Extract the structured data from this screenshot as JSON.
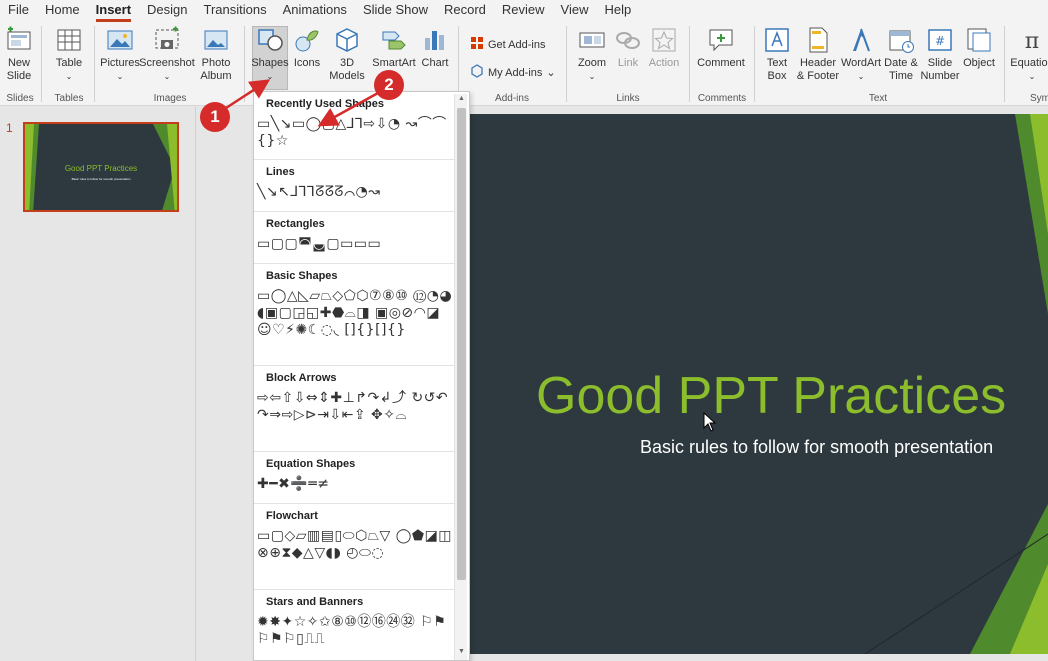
{
  "menu": {
    "tabs": [
      "File",
      "Home",
      "Insert",
      "Design",
      "Transitions",
      "Animations",
      "Slide Show",
      "Record",
      "Review",
      "View",
      "Help"
    ],
    "active": "Insert"
  },
  "ribbon": {
    "new_slide": "New",
    "new_slide2": "Slide",
    "table": "Table",
    "pictures": "Pictures",
    "screenshot": "Screenshot",
    "photo_album": "Photo",
    "photo_album2": "Album",
    "shapes": "Shapes",
    "icons": "Icons",
    "models": "3D",
    "models2": "Models",
    "smartart": "SmartArt",
    "chart": "Chart",
    "get_addins": "Get Add-ins",
    "my_addins": "My Add-ins",
    "zoom": "Zoom",
    "link": "Link",
    "action": "Action",
    "comment": "Comment",
    "text_box": "Text",
    "text_box2": "Box",
    "header_footer": "Header",
    "header_footer2": "& Footer",
    "wordart": "WordArt",
    "date_time": "Date &",
    "date_time2": "Time",
    "slide_number": "Slide",
    "slide_number2": "Number",
    "object": "Object",
    "equation": "Equation",
    "groups": {
      "slides": "Slides",
      "tables": "Tables",
      "images": "Images",
      "addins": "Add-ins",
      "links": "Links",
      "comments": "Comments",
      "text": "Text",
      "symbols": "Sym"
    }
  },
  "thumbnail": {
    "number": "1",
    "title": "Good PPT Practices",
    "subtitle": "Basic rules to follow for smooth presentation"
  },
  "slide": {
    "title": "Good PPT Practices",
    "subtitle": "Basic rules to follow for smooth presentation"
  },
  "shapes_menu": {
    "recent": "Recently Used Shapes",
    "lines": "Lines",
    "rectangles": "Rectangles",
    "basic": "Basic Shapes",
    "block_arrows": "Block Arrows",
    "equation": "Equation Shapes",
    "flowchart": "Flowchart",
    "stars": "Stars and Banners"
  },
  "markers": {
    "one": "1",
    "two": "2"
  },
  "colors": {
    "accent": "#c43e1c",
    "slide_bg": "#2d393e",
    "title_green": "#8cbd2c",
    "marker_red": "#d52b2b"
  }
}
